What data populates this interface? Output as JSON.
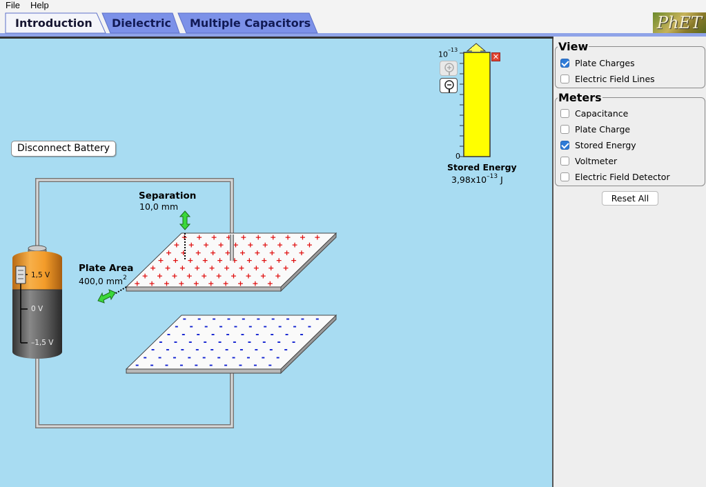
{
  "menu": {
    "file": "File",
    "help": "Help"
  },
  "tabs": [
    {
      "label": "Introduction",
      "active": true
    },
    {
      "label": "Dielectric",
      "active": false
    },
    {
      "label": "Multiple Capacitors",
      "active": false
    }
  ],
  "logo": {
    "text": "PhET"
  },
  "play_area": {
    "disconnect_button": "Disconnect Battery",
    "separation": {
      "title": "Separation",
      "value": "10,0 mm"
    },
    "plate_area": {
      "title": "Plate Area",
      "value": "400,0 mm",
      "unit_sup": "2"
    },
    "battery": {
      "top_label": "1,5 V",
      "mid_label": "0 V",
      "bottom_label": "–1,5 V",
      "level": 1.5
    },
    "energy_meter": {
      "exp_base": "10",
      "exp_power": "–13",
      "zero_label": "0",
      "title": "Stored Energy",
      "value_base": "3,98x10",
      "value_power": "–13",
      "value_unit": "J",
      "fill_fraction": 1.0
    }
  },
  "control_panel": {
    "view": {
      "title": "View",
      "items": [
        {
          "label": "Plate Charges",
          "checked": true
        },
        {
          "label": "Electric Field Lines",
          "checked": false
        }
      ]
    },
    "meters": {
      "title": "Meters",
      "items": [
        {
          "label": "Capacitance",
          "checked": false
        },
        {
          "label": "Plate Charge",
          "checked": false
        },
        {
          "label": "Stored Energy",
          "checked": true
        },
        {
          "label": "Voltmeter",
          "checked": false
        },
        {
          "label": "Electric Field Detector",
          "checked": false
        }
      ]
    },
    "reset": "Reset All"
  },
  "colors": {
    "play_bg": "#a8dcf2",
    "positive_charge": "#e01010",
    "negative_charge": "#1020d0",
    "meter_fill": "#ffff00",
    "checkbox_on": "#2f7bd7"
  }
}
